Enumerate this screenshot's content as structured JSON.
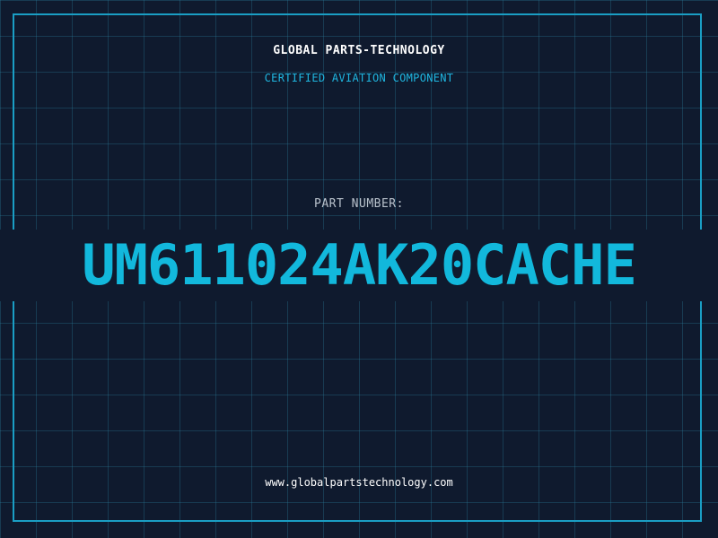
{
  "header": {
    "company": "GLOBAL PARTS-TECHNOLOGY",
    "subtitle": "CERTIFIED AVIATION COMPONENT"
  },
  "part": {
    "label": "PART NUMBER:",
    "number": "UM611024AK20CACHE"
  },
  "footer": {
    "url": "www.globalpartstechnology.com"
  },
  "colors": {
    "background": "#0f1a2e",
    "grid": "#287896",
    "accent": "#12b8dc",
    "frame": "#1a9ec4"
  }
}
